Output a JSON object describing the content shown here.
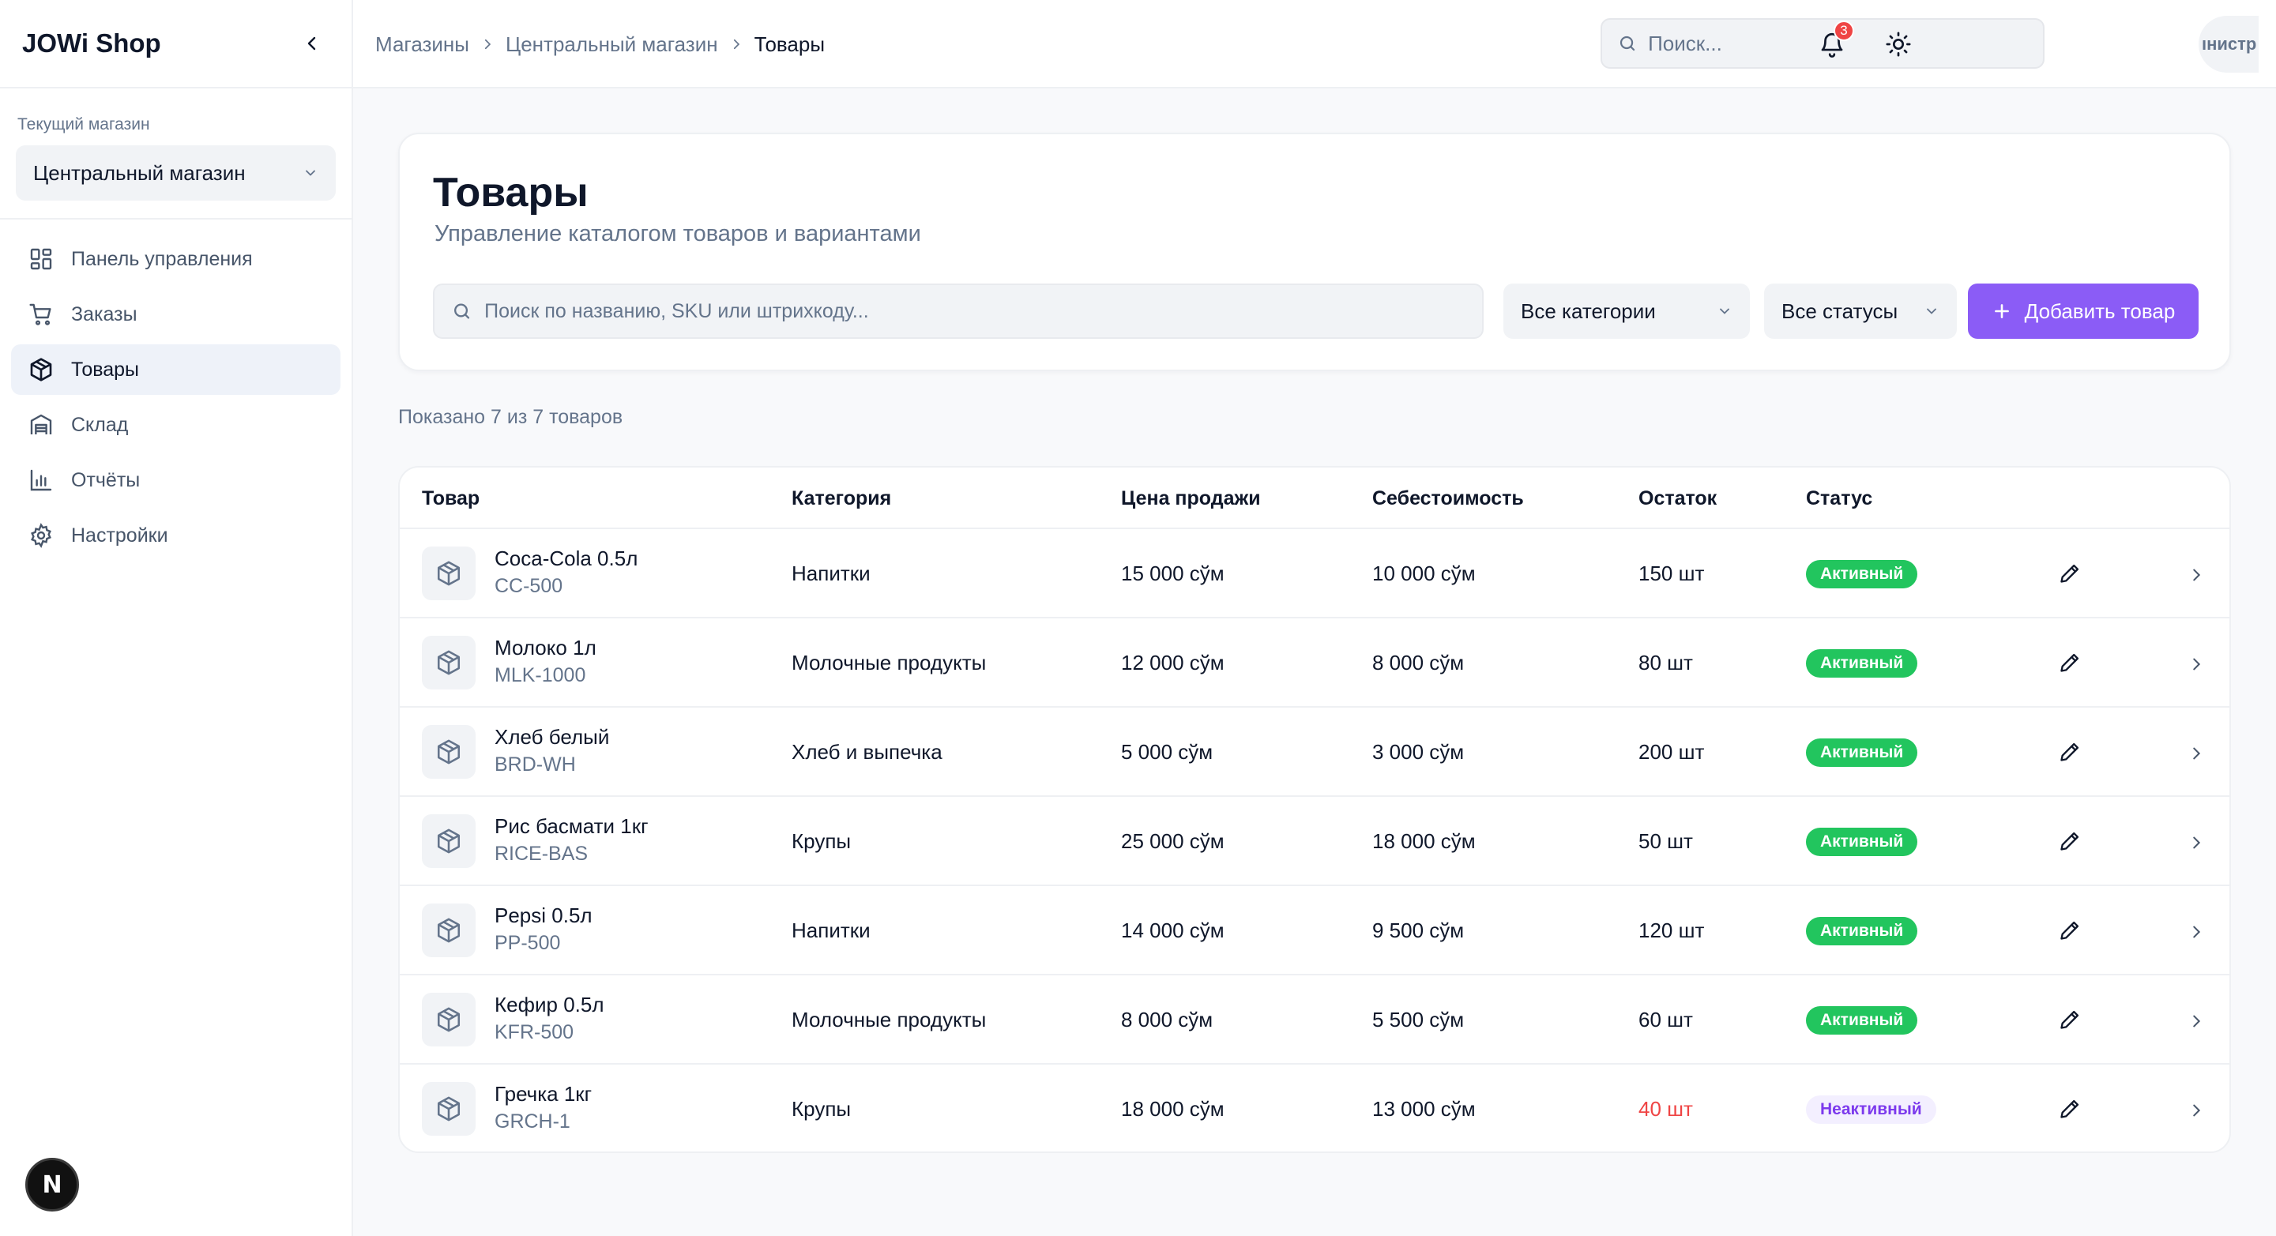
{
  "sidebar": {
    "brand": "JOWi Shop",
    "store_caption": "Текущий магазин",
    "store_value": "Центральный магазин",
    "items": [
      {
        "label": "Панель управления",
        "icon": "dashboard-icon"
      },
      {
        "label": "Заказы",
        "icon": "cart-icon"
      },
      {
        "label": "Товары",
        "icon": "box-icon",
        "active": true
      },
      {
        "label": "Склад",
        "icon": "warehouse-icon"
      },
      {
        "label": "Отчёты",
        "icon": "chart-icon"
      },
      {
        "label": "Настройки",
        "icon": "gear-icon"
      }
    ],
    "dev_badge": "N"
  },
  "topbar": {
    "breadcrumb": [
      "Магазины",
      "Центральный магазин",
      "Товары"
    ],
    "search_placeholder": "Поиск...",
    "notifications_count": "3",
    "avatar_text": "ıнистр"
  },
  "header": {
    "title": "Товары",
    "subtitle": "Управление каталогом товаров и вариантами",
    "search_placeholder": "Поиск по названию, SKU или штрихкоду...",
    "category_filter": "Все категории",
    "status_filter": "Все статусы",
    "add_button": "Добавить товар"
  },
  "summary": "Показано 7 из 7 товаров",
  "table": {
    "columns": [
      "Товар",
      "Категория",
      "Цена продажи",
      "Себестоимость",
      "Остаток",
      "Статус"
    ],
    "rows": [
      {
        "name": "Coca-Cola 0.5л",
        "sku": "CC-500",
        "category": "Напитки",
        "price": "15 000 сўм",
        "cost": "10 000 сўм",
        "stock": "150 шт",
        "status": "Активный",
        "low": false,
        "active": true
      },
      {
        "name": "Молоко 1л",
        "sku": "MLK-1000",
        "category": "Молочные продукты",
        "price": "12 000 сўм",
        "cost": "8 000 сўм",
        "stock": "80 шт",
        "status": "Активный",
        "low": false,
        "active": true
      },
      {
        "name": "Хлеб белый",
        "sku": "BRD-WH",
        "category": "Хлеб и выпечка",
        "price": "5 000 сўм",
        "cost": "3 000 сўм",
        "stock": "200 шт",
        "status": "Активный",
        "low": false,
        "active": true
      },
      {
        "name": "Рис басмати 1кг",
        "sku": "RICE-BAS",
        "category": "Крупы",
        "price": "25 000 сўм",
        "cost": "18 000 сўм",
        "stock": "50 шт",
        "status": "Активный",
        "low": false,
        "active": true
      },
      {
        "name": "Pepsi 0.5л",
        "sku": "PP-500",
        "category": "Напитки",
        "price": "14 000 сўм",
        "cost": "9 500 сўм",
        "stock": "120 шт",
        "status": "Активный",
        "low": false,
        "active": true
      },
      {
        "name": "Кефир 0.5л",
        "sku": "KFR-500",
        "category": "Молочные продукты",
        "price": "8 000 сўм",
        "cost": "5 500 сўм",
        "stock": "60 шт",
        "status": "Активный",
        "low": false,
        "active": true
      },
      {
        "name": "Гречка 1кг",
        "sku": "GRCH-1",
        "category": "Крупы",
        "price": "18 000 сўм",
        "cost": "13 000 сўм",
        "stock": "40 шт",
        "status": "Неактивный",
        "low": true,
        "active": false
      }
    ]
  },
  "colors": {
    "accent": "#8b5cf6",
    "active_badge": "#22c55e",
    "inactive_badge_text": "#7c3aed",
    "low_stock": "#ef4444"
  }
}
